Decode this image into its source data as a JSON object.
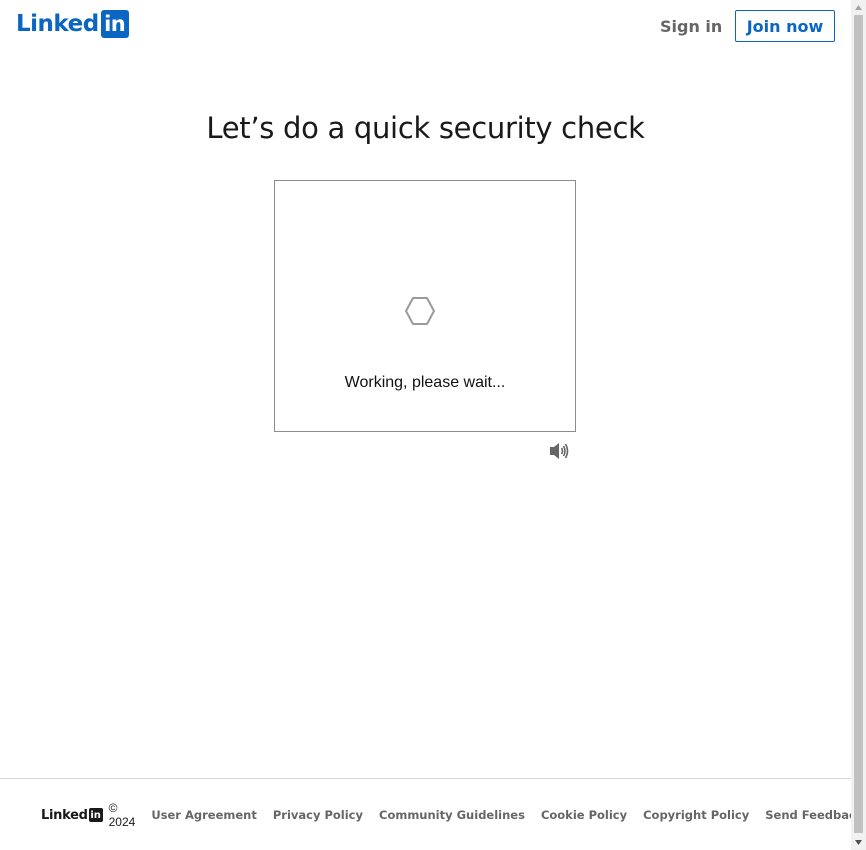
{
  "header": {
    "logo_text": "Linked",
    "logo_box_text": "in",
    "signin_label": "Sign in",
    "join_label": "Join now"
  },
  "main": {
    "title": "Let’s do a quick security check",
    "status_text": "Working, please wait...",
    "audio_icon": "speaker-icon",
    "spinner_icon": "hexagon-spinner-icon"
  },
  "footer": {
    "logo_text": "Linked",
    "logo_box_text": "in",
    "copyright": "© 2024",
    "links": [
      "User Agreement",
      "Privacy Policy",
      "Community Guidelines",
      "Cookie Policy",
      "Copyright Policy",
      "Send Feedback"
    ]
  },
  "colors": {
    "brand": "#0a66c2",
    "muted_text": "#666666",
    "border": "#8c8c8c"
  }
}
